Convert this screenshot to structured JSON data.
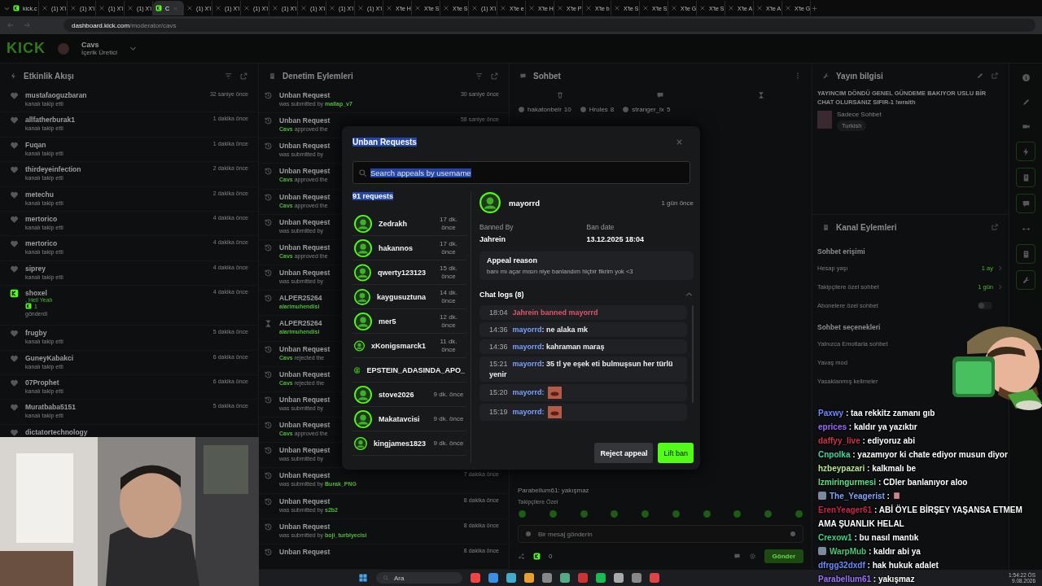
{
  "browser": {
    "tabs": [
      {
        "label": "kick.c",
        "kind": "kick",
        "selected": false
      },
      {
        "label": "(1) X'i",
        "kind": "x",
        "selected": false
      },
      {
        "label": "(1) X'i",
        "kind": "x",
        "selected": false
      },
      {
        "label": "(1) X'i",
        "kind": "x",
        "selected": false
      },
      {
        "label": "(1) X'i",
        "kind": "x",
        "selected": false
      },
      {
        "label": "C",
        "kind": "kick",
        "selected": true
      },
      {
        "label": "(1) X'i",
        "kind": "x",
        "selected": false
      },
      {
        "label": "(1) X'i",
        "kind": "x",
        "selected": false
      },
      {
        "label": "(1) X'i",
        "kind": "x",
        "selected": false
      },
      {
        "label": "(1) X'i",
        "kind": "x",
        "selected": false
      },
      {
        "label": "(1) X'i",
        "kind": "x",
        "selected": false
      },
      {
        "label": "(1) X'i",
        "kind": "x",
        "selected": false
      },
      {
        "label": "(1) X'i",
        "kind": "x",
        "selected": false
      },
      {
        "label": "X'te H",
        "kind": "x",
        "selected": false
      },
      {
        "label": "X'te S",
        "kind": "x",
        "selected": false
      },
      {
        "label": "X'te S",
        "kind": "x",
        "selected": false
      },
      {
        "label": "(1) X'i",
        "kind": "x",
        "selected": false
      },
      {
        "label": "X'te e",
        "kind": "x",
        "selected": false
      },
      {
        "label": "X'te H",
        "kind": "x",
        "selected": false
      },
      {
        "label": "X'te P",
        "kind": "x",
        "selected": false
      },
      {
        "label": "X'te b",
        "kind": "x",
        "selected": false
      },
      {
        "label": "X'te S",
        "kind": "x",
        "selected": false
      },
      {
        "label": "X'te S",
        "kind": "x",
        "selected": false
      },
      {
        "label": "X'te G",
        "kind": "x",
        "selected": false
      },
      {
        "label": "X'te S",
        "kind": "x",
        "selected": false
      },
      {
        "label": "X'te A",
        "kind": "x",
        "selected": false
      },
      {
        "label": "X'te A",
        "kind": "x",
        "selected": false
      },
      {
        "label": "X'te G",
        "kind": "x",
        "selected": false
      }
    ],
    "url_host": "dashboard.kick.com",
    "url_path": "/moderator/cavs"
  },
  "header": {
    "logo": "KICK",
    "channel": "Cavs",
    "role": "İçerik Üretici"
  },
  "activity": {
    "title": "Etkinlik Akışı",
    "items": [
      {
        "kind": "follow",
        "name": "mustafaoguzbaran",
        "sub": "kanalı takip etti",
        "time": "32 saniye önce"
      },
      {
        "kind": "follow",
        "name": "allfatherburak1",
        "sub": "kanalı takip etti",
        "time": "1 dakika önce"
      },
      {
        "kind": "follow",
        "name": "Fuqan",
        "sub": "kanalı takip etti",
        "time": "1 dakika önce"
      },
      {
        "kind": "follow",
        "name": "thirdeyeinfection",
        "sub": "kanalı takip etti",
        "time": "2 dakika önce"
      },
      {
        "kind": "follow",
        "name": "metechu",
        "sub": "kanalı takip etti",
        "time": "2 dakika önce"
      },
      {
        "kind": "follow",
        "name": "mertorico",
        "sub": "kanalı takip etti",
        "time": "4 dakika önce"
      },
      {
        "kind": "follow",
        "name": "mertorico",
        "sub": "kanalı takip etti",
        "time": "4 dakika önce"
      },
      {
        "kind": "follow",
        "name": "siprey",
        "sub": "kanalı takip etti",
        "time": "4 dakika önce"
      },
      {
        "kind": "gift",
        "name": "shoxel",
        "message": ", Hell Yeah",
        "count": "1",
        "sub": "gönderdi",
        "time": "4 dakika önce"
      },
      {
        "kind": "follow",
        "name": "frugby",
        "sub": "kanalı takip etti",
        "time": "5 dakika önce"
      },
      {
        "kind": "follow",
        "name": "GuneyKabakci",
        "sub": "kanalı takip etti",
        "time": "6 dakika önce"
      },
      {
        "kind": "follow",
        "name": "07Prophet",
        "sub": "kanalı takip etti",
        "time": "6 dakika önce"
      },
      {
        "kind": "follow",
        "name": "Muratbaba5151",
        "sub": "kanalı takip etti",
        "time": "5 dakika önce"
      },
      {
        "kind": "follow",
        "name": "dictatortechnology"
      }
    ]
  },
  "moderation": {
    "title": "Denetim Eylemleri",
    "items": [
      {
        "kind": "history",
        "title": "Unban Request",
        "action": "was submitted by",
        "by": "mallap_v7",
        "time": "30 saniye önce"
      },
      {
        "kind": "history",
        "title": "Unban Request",
        "actor": "Cavs",
        "action": "approved the",
        "time": "58 saniye önce"
      },
      {
        "kind": "history",
        "title": "Unban Request",
        "action": "was submitted by"
      },
      {
        "kind": "history",
        "title": "Unban Request",
        "actor": "Cavs",
        "action": "approved the"
      },
      {
        "kind": "history",
        "title": "Unban Request",
        "actor": "Cavs",
        "action": "approved the"
      },
      {
        "kind": "history",
        "title": "Unban Request",
        "action": "was submitted by"
      },
      {
        "kind": "history",
        "title": "Unban Request",
        "actor": "Cavs",
        "action": "approved the"
      },
      {
        "kind": "history",
        "title": "Unban Request",
        "action": "was submitted by"
      },
      {
        "kind": "history",
        "title": "ALPER25264",
        "actor": "alarimuhendisi"
      },
      {
        "kind": "timeout",
        "title": "ALPER25264",
        "actor": "alarimuhendisi"
      },
      {
        "kind": "history",
        "title": "Unban Request",
        "actor": "Cavs",
        "action": "rejected the"
      },
      {
        "kind": "history",
        "title": "Unban Request",
        "actor": "Cavs",
        "action": "rejected the"
      },
      {
        "kind": "history",
        "title": "Unban Request",
        "action": "was submitted by"
      },
      {
        "kind": "history",
        "title": "Unban Request",
        "actor": "Cavs",
        "action": "approved the"
      },
      {
        "kind": "history",
        "title": "Unban Request",
        "action": "was submitted by"
      },
      {
        "kind": "history",
        "title": "Unban Request",
        "action": "was submitted by",
        "by": "Burak_PNG",
        "time": "7 dakika önce"
      },
      {
        "kind": "history",
        "title": "Unban Request",
        "action": "was submitted by",
        "by": "s2b2",
        "time": "8 dakika önce"
      },
      {
        "kind": "history",
        "title": "Unban Request",
        "action": "was submitted by",
        "by": "boji_turbiyecisi",
        "time": "8 dakika önce"
      },
      {
        "kind": "history",
        "title": "Unban Request",
        "time": "8 dakika önce"
      }
    ]
  },
  "chat": {
    "title": "Sohbet",
    "chips": [
      {
        "name": "hakatonbeir",
        "count": "10"
      },
      {
        "name": "Hrules",
        "count": "8"
      },
      {
        "name": "stranger_lx",
        "count": "5"
      }
    ],
    "last_message": {
      "user": "Parabellum61",
      "text": ": yakışmaz"
    },
    "mode": "Takipçilere Özel",
    "placeholder": "Bir mesaj gönderin",
    "counter": "0",
    "send": "Gönder"
  },
  "stream_info": {
    "title": "Yayın bilgisi",
    "stream_title": "YAYINCIM DÖNDÜ GENEL GÜNDEME BAKIYOR USLU BİR CHAT OLURSANIZ SIFIR-1 !wraith",
    "category": "Sadece Sohbet",
    "tag": "Turkish"
  },
  "channel_actions": {
    "title": "Kanal Eylemleri",
    "sections": [
      {
        "title": "Sohbet erişimi",
        "rows": [
          {
            "kind": "value",
            "label": "Hesap yaşı",
            "value": "1 ay"
          },
          {
            "kind": "value",
            "label": "Takipçilere özel sohbet",
            "value": "1 gün"
          },
          {
            "kind": "toggle",
            "label": "Abonelere özel sohbet",
            "on": false
          }
        ]
      },
      {
        "title": "Sohbet seçenekleri",
        "rows": [
          {
            "kind": "plain",
            "label": "Yalnızca Emotlarla sohbet"
          },
          {
            "kind": "plain",
            "label": "Yavaş mod"
          },
          {
            "kind": "plain",
            "label": "Yasaklanmış kelimeler"
          }
        ]
      }
    ]
  },
  "modal": {
    "title": {
      "text": "Unban Requests",
      "highlighted": true
    },
    "search": {
      "placeholder": "Search appeals by username",
      "highlighted": true
    },
    "count": {
      "text": "91 requests",
      "highlighted": true
    },
    "requests": [
      {
        "name": "Zedrakh",
        "time": "17 dk. önce"
      },
      {
        "name": "hakannos",
        "time": "17 dk. önce"
      },
      {
        "name": "qwerty123123",
        "time": "15 dk. önce"
      },
      {
        "name": "kaygusuztuna",
        "time": "14 dk. önce"
      },
      {
        "name": "mer5",
        "time": "12 dk. önce"
      },
      {
        "name": "xKonigsmarck1",
        "time": "11 dk. önce"
      },
      {
        "name": "EPSTEIN_ADASINDA_APO_"
      },
      {
        "name": "stove2026",
        "time": "9 dk. önce"
      },
      {
        "name": "Makatavcisi",
        "time": "9 dk. önce"
      },
      {
        "name": "kingjames1823",
        "time": "9 dk. önce"
      }
    ],
    "detail": {
      "user": "mayorrd",
      "age": "1 gün önce",
      "banned_by_label": "Banned By",
      "banned_by": "Jahrein",
      "ban_date_label": "Ban date",
      "ban_date": "13.12.2025 18:04",
      "reason_label": "Appeal reason",
      "reason": "banı mı açar mısın niye banlandım hiçbir fikrim yok <3",
      "logs_title": "Chat logs (8)",
      "expanded": true,
      "logs": [
        {
          "kind": "ban",
          "time": "18:04",
          "text": "Jahrein banned mayorrd"
        },
        {
          "kind": "message",
          "time": "14:36",
          "user": "mayorrd",
          "text": ": ne alaka mk"
        },
        {
          "kind": "message",
          "time": "14:36",
          "user": "mayorrd",
          "text": ": kahraman maraş"
        },
        {
          "kind": "message",
          "time": "15:21",
          "user": "mayorrd",
          "text": ": 35 tl ye eşek eti bulmuşsun her türlü yenir"
        },
        {
          "kind": "emote",
          "time": "15:20",
          "user": "mayorrd",
          "text": ":"
        },
        {
          "kind": "emote",
          "time": "15:19",
          "user": "mayorrd",
          "text": ":"
        }
      ]
    },
    "buttons": [
      {
        "kind": "secondary",
        "label": "Reject appeal"
      },
      {
        "kind": "primary",
        "label": "Lift ban"
      }
    ]
  },
  "overlay_chat": [
    {
      "user": "Paxwy",
      "color": "#6c8cff",
      "text": ": taa rekkitz zamanı gıb"
    },
    {
      "user": "eprices",
      "color": "#9c6cff",
      "text": ": kaldır ya yazıktır"
    },
    {
      "user": "daffyy_live",
      "color": "#d2304c",
      "text": ": ediyoruz abi"
    },
    {
      "user": "Cnpolka",
      "color": "#46d6a0",
      "text": ": yazamıyor ki chate ediyor musun diyor"
    },
    {
      "user": "hzbeypazari",
      "color": "#b8e986",
      "text": ": kalkmalı be"
    },
    {
      "user": "Izmiringurmesi",
      "color": "#5ce08a",
      "text": ": CDler banlanıyor aloo"
    },
    {
      "user": "The_Yeagerist",
      "color": "#7fa4ff",
      "text": ":",
      "badge": true,
      "emote": true
    },
    {
      "user": "ErenYeager61",
      "color": "#c8254a",
      "text": ": ABİ ÖYLE BİRŞEY YAŞANSA ETMEM AMA ŞUANLIK HELAL"
    },
    {
      "user": "Crexow1",
      "color": "#3fd28a",
      "text": ": bu nasıl mantık"
    },
    {
      "user": "WarpMub",
      "color": "#48c878",
      "text": ": kaldır abi ya",
      "badge": true
    },
    {
      "user": "dfrgg32dxdf",
      "color": "#6b8cff",
      "text": ": hak hukuk adalet"
    },
    {
      "user": "Parabellum61",
      "color": "#a070ff",
      "text": ": yakışmaz"
    }
  ],
  "taskbar": {
    "search": "Ara",
    "time": "1:54:22 ÖS",
    "date": "9.08.2026"
  }
}
